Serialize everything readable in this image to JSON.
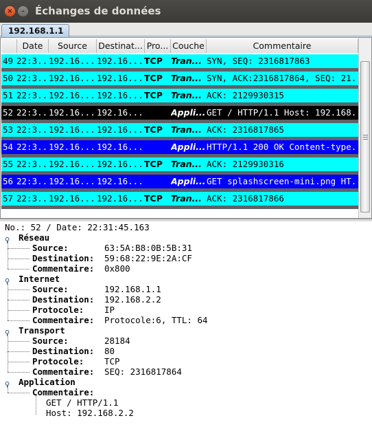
{
  "window": {
    "title": "Échanges de données",
    "close_glyph": "×",
    "min_glyph": "–"
  },
  "tab": {
    "label": "192.168.1.1"
  },
  "table": {
    "headers": [
      "",
      "Date",
      "Source",
      "Destinat...",
      "Pro...",
      "Couche",
      "Commentaire"
    ],
    "rows": [
      {
        "no": "49",
        "date": "22:3...",
        "source": "192.16...",
        "dest": "192.16...",
        "proto": "TCP",
        "layer": "Tran...",
        "comment": "SYN, SEQ: 2316817863"
      },
      {
        "no": "50",
        "date": "22:3...",
        "source": "192.16...",
        "dest": "192.16...",
        "proto": "TCP",
        "layer": "Tran...",
        "comment": "SYN, ACK:2316817864, SEQ: 21..."
      },
      {
        "no": "51",
        "date": "22:3...",
        "source": "192.16...",
        "dest": "192.16...",
        "proto": "TCP",
        "layer": "Tran...",
        "comment": "ACK: 2129930315"
      },
      {
        "no": "52",
        "date": "22:3...",
        "source": "192.16...",
        "dest": "192.16...",
        "proto": "",
        "layer": "Appli...",
        "comment": "GET / HTTP/1.1 Host: 192.168..."
      },
      {
        "no": "53",
        "date": "22:3...",
        "source": "192.16...",
        "dest": "192.16...",
        "proto": "TCP",
        "layer": "Tran...",
        "comment": "ACK: 2316817865"
      },
      {
        "no": "54",
        "date": "22:3...",
        "source": "192.16...",
        "dest": "192.16...",
        "proto": "",
        "layer": "Appli...",
        "comment": "HTTP/1.1 200 OK Content-type..."
      },
      {
        "no": "55",
        "date": "22:3...",
        "source": "192.16...",
        "dest": "192.16...",
        "proto": "TCP",
        "layer": "Tran...",
        "comment": "ACK: 2129930316"
      },
      {
        "no": "56",
        "date": "22:3...",
        "source": "192.16...",
        "dest": "192.16...",
        "proto": "",
        "layer": "Appli...",
        "comment": "GET splashscreen-mini.png HT..."
      },
      {
        "no": "57",
        "date": "22:3...",
        "source": "192.16...",
        "dest": "192.16...",
        "proto": "TCP",
        "layer": "Tran...",
        "comment": "ACK: 2316817866"
      }
    ],
    "row_colors": {
      "tcp": "#00ffff",
      "selected": "#000000",
      "http": "#0000ff",
      "separator": "#5d6266"
    }
  },
  "details": {
    "header": "No.: 52 / Date: 22:31:45.163",
    "sections": [
      {
        "title": "Réseau",
        "fields": [
          {
            "key": "Source:",
            "value": "63:5A:B8:0B:5B:31"
          },
          {
            "key": "Destination:",
            "value": "59:68:22:9E:2A:CF"
          },
          {
            "key": "Commentaire:",
            "value": "0x800"
          }
        ]
      },
      {
        "title": "Internet",
        "fields": [
          {
            "key": "Source:",
            "value": "192.168.1.1"
          },
          {
            "key": "Destination:",
            "value": "192.168.2.2"
          },
          {
            "key": "Protocole:",
            "value": "IP"
          },
          {
            "key": "Commentaire:",
            "value": "Protocole:6, TTL: 64"
          }
        ]
      },
      {
        "title": "Transport",
        "fields": [
          {
            "key": "Source:",
            "value": "28184"
          },
          {
            "key": "Destination:",
            "value": "80"
          },
          {
            "key": "Protocole:",
            "value": "TCP"
          },
          {
            "key": "Commentaire:",
            "value": "SEQ: 2316817864"
          }
        ]
      },
      {
        "title": "Application",
        "fields": [
          {
            "key": "Commentaire:",
            "value": ""
          }
        ],
        "lines": [
          "GET / HTTP/1.1",
          "Host: 192.168.2.2"
        ]
      }
    ]
  }
}
